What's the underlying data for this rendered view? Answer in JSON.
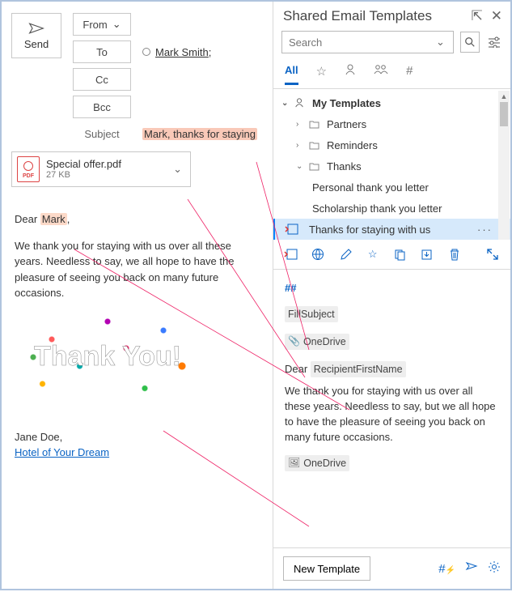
{
  "compose": {
    "send_label": "Send",
    "from_label": "From",
    "to_label": "To",
    "cc_label": "Cc",
    "bcc_label": "Bcc",
    "subject_label": "Subject",
    "recipient_name": "Mark Smith",
    "subject_value": "Mark, thanks for staying",
    "attachment": {
      "name": "Special offer.pdf",
      "size": "27 KB",
      "badge": "PDF"
    },
    "body": {
      "greeting_prefix": "Dear ",
      "greeting_name": "Mark",
      "greeting_suffix": ",",
      "para1": "We thank you for staying with us over all these years. Needless to say, we all hope to have the pleasure of seeing you back on many future occasions.",
      "image_text": "Thank You!",
      "signature_name": "Jane Doe,",
      "signature_link": "Hotel of Your Dream"
    }
  },
  "templates": {
    "title": "Shared Email Templates",
    "search_placeholder": "Search",
    "tabs": {
      "all": "All"
    },
    "tree": {
      "root": "My Templates",
      "folders": [
        "Partners",
        "Reminders",
        "Thanks"
      ],
      "thanks_items": [
        "Personal thank you letter",
        "Scholarship thank you letter",
        "Thanks for staying with us"
      ]
    },
    "preview": {
      "macros_label": "##",
      "fillsubject": "FillSubject",
      "onedrive": "OneDrive",
      "greeting_prefix": "Dear ",
      "recipient_token": "RecipientFirstName",
      "para1": "We thank you for staying with us over all these years. Needless  to say, but we all hope to have the pleasure of seeing you back on many future occasions."
    },
    "new_template_label": "New Template"
  }
}
